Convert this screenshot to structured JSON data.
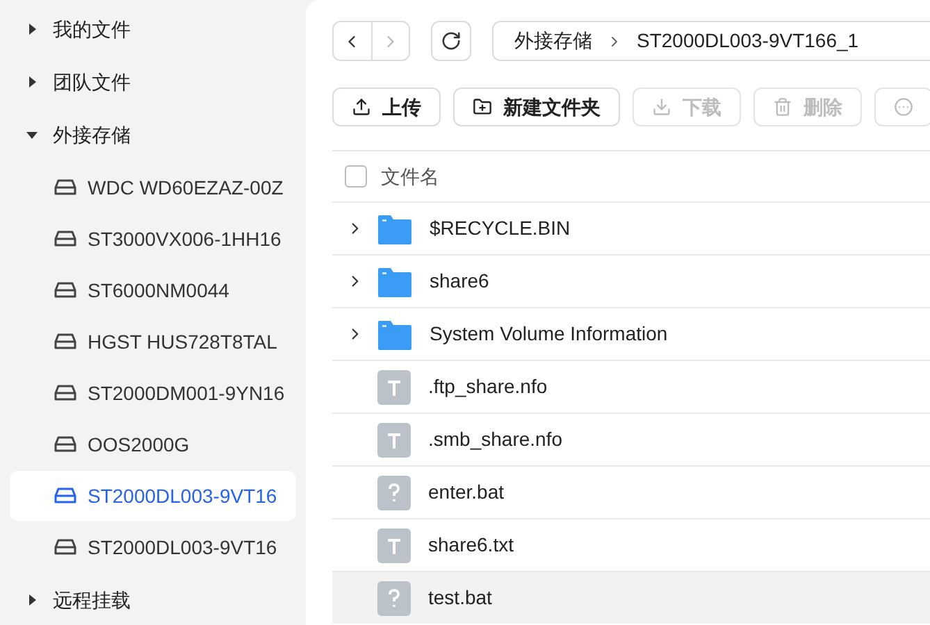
{
  "sidebar": {
    "items": [
      {
        "label": "我的文件",
        "kind": "group",
        "expanded": false
      },
      {
        "label": "团队文件",
        "kind": "group",
        "expanded": false
      },
      {
        "label": "外接存储",
        "kind": "group",
        "expanded": true,
        "children": [
          {
            "label": "WDC WD60EZAZ-00Z",
            "kind": "disk",
            "selected": false
          },
          {
            "label": "ST3000VX006-1HH16",
            "kind": "disk",
            "selected": false
          },
          {
            "label": "ST6000NM0044",
            "kind": "disk",
            "selected": false
          },
          {
            "label": "HGST HUS728T8TAL",
            "kind": "disk",
            "selected": false
          },
          {
            "label": "ST2000DM001-9YN16",
            "kind": "disk",
            "selected": false
          },
          {
            "label": "OOS2000G",
            "kind": "disk",
            "selected": false
          },
          {
            "label": "ST2000DL003-9VT16",
            "kind": "disk",
            "selected": true
          },
          {
            "label": "ST2000DL003-9VT16",
            "kind": "disk",
            "selected": false
          }
        ]
      },
      {
        "label": "远程挂载",
        "kind": "group",
        "expanded": false
      }
    ]
  },
  "breadcrumb": [
    "外接存储",
    "ST2000DL003-9VT166_1"
  ],
  "toolbar": [
    {
      "label": "上传",
      "kind": "upload",
      "disabled": false
    },
    {
      "label": "新建文件夹",
      "kind": "new-folder",
      "disabled": false
    },
    {
      "label": "下载",
      "kind": "download",
      "disabled": true
    },
    {
      "label": "删除",
      "kind": "delete",
      "disabled": true
    },
    {
      "kind": "more",
      "disabled": true
    }
  ],
  "table": {
    "header": {
      "label": "文件名",
      "checked": false
    },
    "rows": [
      {
        "name": "$RECYCLE.BIN",
        "kind": "folder",
        "selected": false
      },
      {
        "name": "share6",
        "kind": "folder",
        "selected": false
      },
      {
        "name": "System Volume Information",
        "kind": "folder",
        "selected": false
      },
      {
        "name": ".ftp_share.nfo",
        "kind": "text",
        "selected": false
      },
      {
        "name": ".smb_share.nfo",
        "kind": "text",
        "selected": false
      },
      {
        "name": "enter.bat",
        "kind": "unknown",
        "selected": false
      },
      {
        "name": "share6.txt",
        "kind": "text",
        "selected": false
      },
      {
        "name": "test.bat",
        "kind": "unknown",
        "selected": true
      }
    ]
  }
}
